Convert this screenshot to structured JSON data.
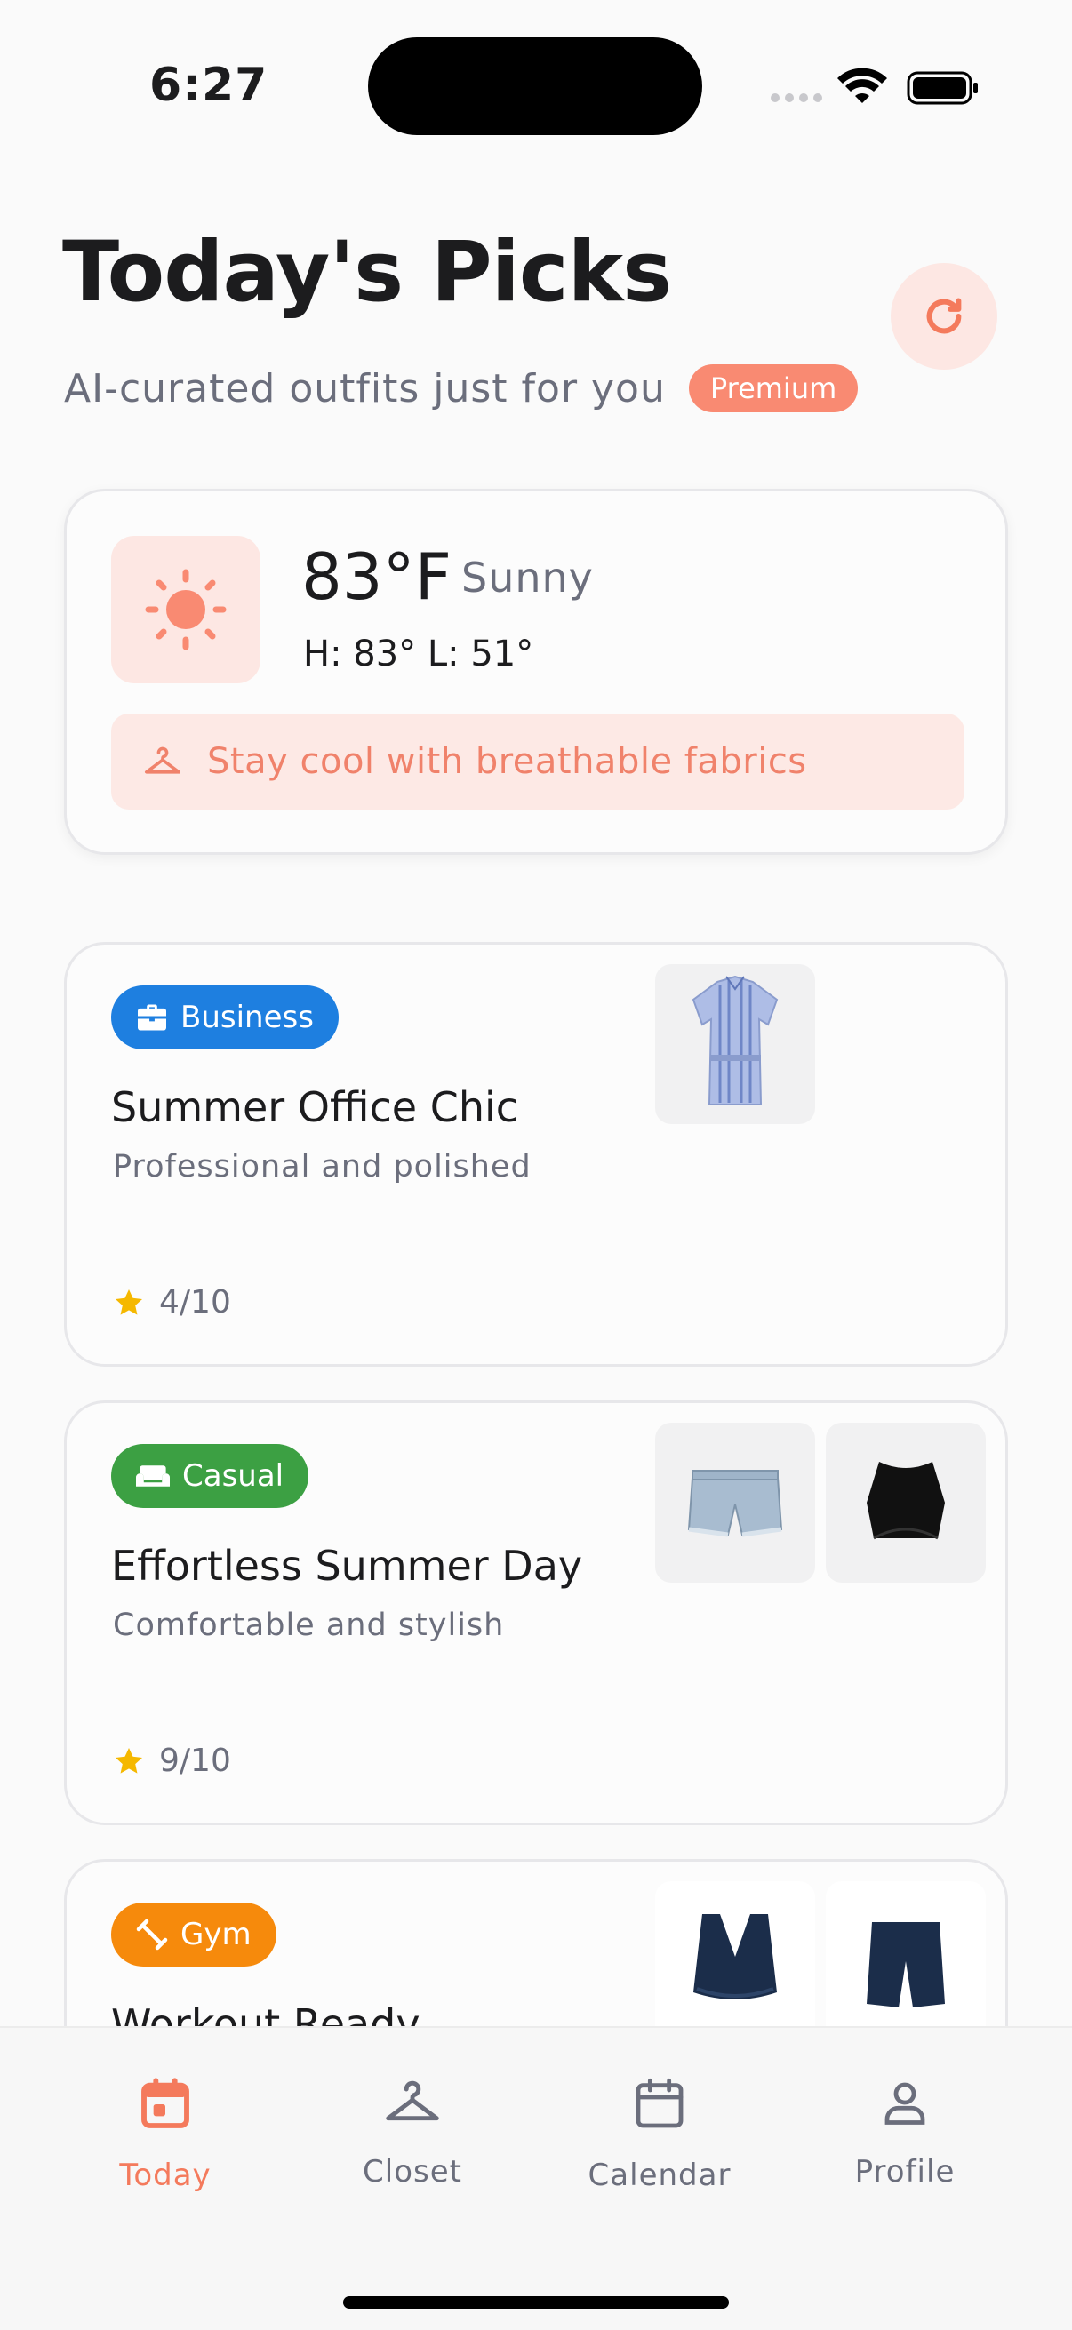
{
  "status": {
    "time": "6:27"
  },
  "header": {
    "title": "Today's Picks",
    "subtitle": "AI-curated outfits just for you",
    "badge": "Premium"
  },
  "weather": {
    "temp": "83°F",
    "condition": "Sunny",
    "hilo": "H: 83° L: 51°",
    "tip": "Stay cool with breathable fabrics",
    "icon": "sun-icon"
  },
  "outfits": [
    {
      "category": "Business",
      "category_color": "#1e7fe0",
      "title": "Summer Office Chic",
      "description": "Professional and polished",
      "rating": "4/10",
      "items": [
        "striped-shirt-dress"
      ]
    },
    {
      "category": "Casual",
      "category_color": "#3ca043",
      "title": "Effortless Summer Day",
      "description": "Comfortable and stylish",
      "rating": "9/10",
      "items": [
        "denim-shorts",
        "black-crop-top"
      ]
    },
    {
      "category": "Gym",
      "category_color": "#f68a0c",
      "title": "Workout Ready",
      "description": "",
      "rating": "",
      "items": [
        "navy-sports-bra",
        "navy-bike-shorts"
      ]
    }
  ],
  "tabs": [
    {
      "label": "Today",
      "icon": "calendar-today-icon",
      "active": true
    },
    {
      "label": "Closet",
      "icon": "hanger-icon",
      "active": false
    },
    {
      "label": "Calendar",
      "icon": "calendar-icon",
      "active": false
    },
    {
      "label": "Profile",
      "icon": "person-icon",
      "active": false
    }
  ],
  "colors": {
    "accent": "#f47a5c",
    "accent_bg": "#fde7e3",
    "muted": "#6b6e7c"
  }
}
